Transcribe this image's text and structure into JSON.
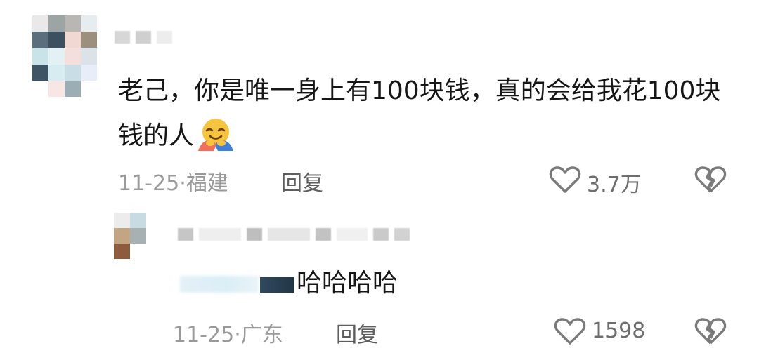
{
  "comment": {
    "avatar_colors": [
      "#e9e9ea",
      "#9ca5a3",
      "#b9b7b4",
      "#e7ecee",
      "#5b6e7e",
      "#3d5060",
      "#f2d8d3",
      "#9d8f7e",
      "#c9e3e9",
      "#e3f1f4",
      "#f4dfdc",
      "#dbe3e8",
      "#3f5566",
      "#d6ecf0",
      "#c8dde4",
      "#e8eef9",
      "#ffffff",
      "#f7e6e3",
      "#9dadb5",
      "#ffffff"
    ],
    "name_blur_colors": [
      "#d7d7d7",
      "#cfcfcf",
      "#ededed"
    ],
    "text": "老己，你是唯一身上有100块钱，真的会给我花100块钱的人",
    "emoji_icon": "hugging-face-icon",
    "time": "11-25",
    "location": "福建",
    "reply_label": "回复",
    "likes": "3.7万"
  },
  "reply": {
    "avatar_colors": [
      "#ececec",
      "#c9dbe2",
      "#c2a683",
      "#a7b0b3",
      "#8d5b3d",
      "#ffffff"
    ],
    "name_blur_colors": [
      "#c6c6c6",
      "#eeeeee",
      "#bebebe",
      "#e6e6e6",
      "#c2c2c2",
      "#f0f0f0",
      "#cacaca",
      "#d2d2d2"
    ],
    "text": "哈哈哈哈",
    "time": "11-25",
    "location": "广东",
    "reply_label": "回复",
    "likes": "1598"
  }
}
